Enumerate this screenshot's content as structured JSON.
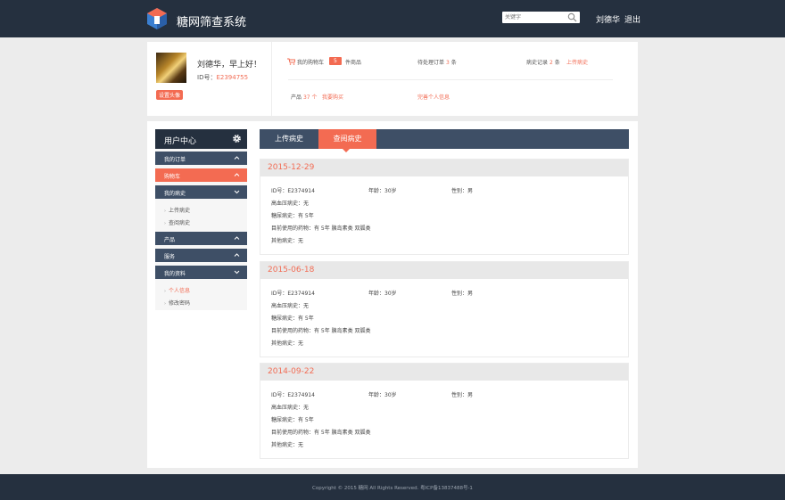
{
  "header": {
    "site_title": "糖网筛查系统",
    "search_placeholder": "关键字",
    "user_name": "刘德华",
    "logout": "退出"
  },
  "profile": {
    "greeting": "刘德华，早上好！",
    "id_label": "ID号：",
    "id_value": "E2394755",
    "set_avatar": "设置头像",
    "cart_label": "我的购物车",
    "cart_count": "5",
    "cart_unit": "件商品",
    "pending_label": "待处理订单",
    "pending_count": "3",
    "pending_unit": "条",
    "history_label": "病史记录",
    "history_count": "2",
    "history_unit": "条",
    "upload_link": "上传病史",
    "products_label": "产品",
    "products_count": "37",
    "products_unit": "个",
    "buy_link": "我要购买",
    "complete_link": "完善个人信息"
  },
  "sidebar": {
    "title": "用户中心",
    "menu": [
      {
        "label": "我的订单"
      },
      {
        "label": "购物车"
      },
      {
        "label": "我的病史"
      },
      {
        "label": "产品"
      },
      {
        "label": "服务"
      },
      {
        "label": "我的资料"
      }
    ],
    "history_sub": [
      "上传病史",
      "查阅病史"
    ],
    "profile_sub": [
      "个人信息",
      "修改密码"
    ]
  },
  "tabs": {
    "upload": "上传病史",
    "history": "查阅病史"
  },
  "records": [
    {
      "date": "2015-12-29",
      "id": "ID号：E2374914",
      "age": "年龄：30岁",
      "sex": "性别：男",
      "hypertension": "高血压病史：无",
      "diabetes": "糖尿病史：有  5年",
      "drugs": "目前使用的药物：有  5年  胰岛素类  双胍类",
      "other": "其他病史：无"
    },
    {
      "date": "2015-06-18",
      "id": "ID号：E2374914",
      "age": "年龄：30岁",
      "sex": "性别：男",
      "hypertension": "高血压病史：无",
      "diabetes": "糖尿病史：有  5年",
      "drugs": "目前使用的药物：有  5年  胰岛素类  双胍类",
      "other": "其他病史：无"
    },
    {
      "date": "2014-09-22",
      "id": "ID号：E2374914",
      "age": "年龄：30岁",
      "sex": "性别：男",
      "hypertension": "高血压病史：无",
      "diabetes": "糖尿病史：有  5年",
      "drugs": "目前使用的药物：有  5年  胰岛素类  双胍类",
      "other": "其他病史：无"
    }
  ],
  "footer": {
    "copyright": "Copyright © 2015 糖网 All Rights Reserved.    粤ICP备13837488号-1"
  },
  "colors": {
    "header_bg": "#25303f",
    "nav_bg": "#3e4f66",
    "accent": "#f36b52"
  }
}
